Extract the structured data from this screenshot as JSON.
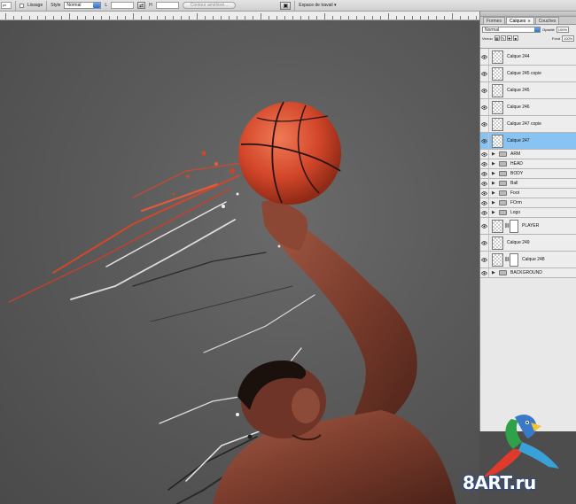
{
  "options_bar": {
    "field_value": "px",
    "lissage_label": "Lissage",
    "style_label": "Style",
    "style_value": "Normal",
    "width_label": "L",
    "height_label": "H",
    "refine_button": "Contour amélioré...",
    "workspace_label": "Espace de travail"
  },
  "layers_panel": {
    "tabs": [
      {
        "label": "Formes",
        "active": false
      },
      {
        "label": "Calques",
        "active": true
      },
      {
        "label": "Couches",
        "active": false
      }
    ],
    "blend_mode": "Normal",
    "opacity_label": "Opacité",
    "opacity_value": "100%",
    "lock_label": "Verrou",
    "fill_label": "Fond",
    "fill_value": "100%",
    "layers": [
      {
        "name": "Calque 244",
        "type": "layer",
        "selected": false
      },
      {
        "name": "Calque 245 copie",
        "type": "layer",
        "selected": false
      },
      {
        "name": "Calque 245",
        "type": "layer",
        "selected": false
      },
      {
        "name": "Calque 246",
        "type": "layer",
        "selected": false
      },
      {
        "name": "Calque 247 copie",
        "type": "layer",
        "selected": false
      },
      {
        "name": "Calque 247",
        "type": "layer",
        "selected": true
      },
      {
        "name": "ARM",
        "type": "group",
        "selected": false
      },
      {
        "name": "HEAD",
        "type": "group",
        "selected": false
      },
      {
        "name": "BODY",
        "type": "group",
        "selected": false
      },
      {
        "name": "Ball",
        "type": "group",
        "selected": false
      },
      {
        "name": "Foot",
        "type": "group",
        "selected": false
      },
      {
        "name": "FOrm",
        "type": "group",
        "selected": false
      },
      {
        "name": "Logo",
        "type": "group",
        "selected": false
      },
      {
        "name": "PLAYER",
        "type": "masked",
        "selected": false
      },
      {
        "name": "Calque 249",
        "type": "layer",
        "selected": false
      },
      {
        "name": "Calque 248",
        "type": "masked",
        "selected": false
      },
      {
        "name": "BACKGROUND",
        "type": "group",
        "selected": false
      }
    ]
  },
  "watermark": {
    "text": "8ART.ru"
  },
  "colors": {
    "selection": "#89c3f2",
    "ball": "#d2462a",
    "background": "#5a5a5a"
  }
}
